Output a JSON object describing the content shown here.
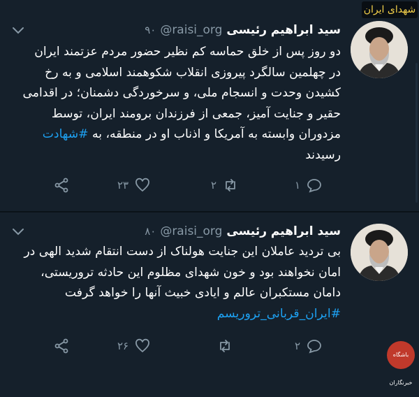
{
  "watermark": {
    "top_text": "شهدای ایران",
    "bottom_text": "باشگاه خبرنگاران"
  },
  "tweets": [
    {
      "display_name": "سید ابراهیم رئیسی",
      "handle": "@raisi_org",
      "time": "۹۰",
      "text_before": "دو روز پس از خلق حماسه کم نظیر حضور مردم عزتمند ایران در چهلمین سالگرد پیروزی انقلاب شکوهمند اسلامی و به رخ کشیدن وحدت و انسجام ملی، و سرخوردگی دشمنان؛ در اقدامی حقیر و جنایت آمیز، جمعی از فرزندان برومند ایران، توسط مزدوران وابسته به آمریکا و اذناب او در منطقه، به",
      "hashtag": "#شهادت",
      "text_after": " رسیدند",
      "replies": "۱",
      "retweets": "۲",
      "likes": "۲۳"
    },
    {
      "display_name": "سید ابراهیم رئیسی",
      "handle": "@raisi_org",
      "time": "۸۰",
      "text_before": "بی تردید عاملان این جنایت هولناک از دست انتقام شدید الهی در امان نخواهند بود و خون شهدای مظلوم این حادثه تروریستی، دامان مستکبران عالم و ایادی خبیث آنها را خواهد گرفت",
      "hashtag": "#ایران_قربانی_تروریسم",
      "text_after": "",
      "replies": "۲",
      "retweets": "",
      "likes": "۲۶"
    }
  ],
  "icons": {
    "reply": "reply-icon",
    "retweet": "retweet-icon",
    "like": "heart-icon",
    "share": "share-icon",
    "more": "chevron-down-icon"
  },
  "colors": {
    "background": "#15202b",
    "text": "#ffffff",
    "muted": "#8899a6",
    "link": "#1da1f2"
  }
}
